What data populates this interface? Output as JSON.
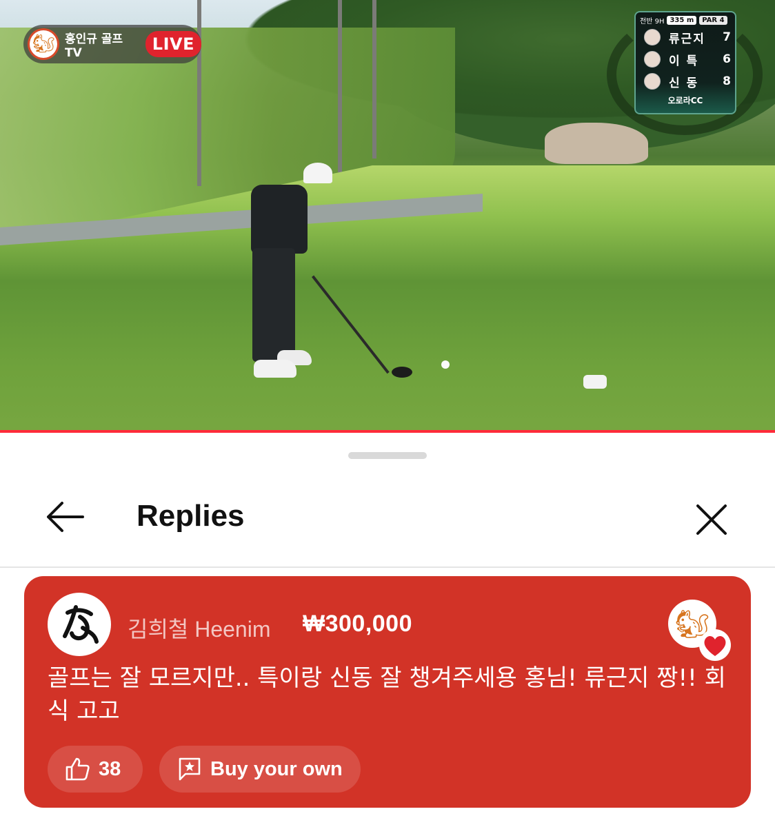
{
  "video": {
    "channel_name": "홍인규 골프TV",
    "live_label": "LIVE",
    "progress": 1.0,
    "scoreboard": {
      "round": "전반 9H",
      "distance": "335 m",
      "par": "PAR 4",
      "players": [
        {
          "name": "류근지",
          "score": "7"
        },
        {
          "name": "이 특",
          "score": "6"
        },
        {
          "name": "신 동",
          "score": "8"
        }
      ],
      "venue": "오로라CC"
    }
  },
  "sheet": {
    "title": "Replies",
    "back_icon": "arrow-left-icon",
    "close_icon": "close-icon"
  },
  "super_chat": {
    "author": "김희철 Heenim",
    "amount": "₩300,000",
    "message": "골프는 잘 모르지만.. 특이랑 신동 잘 챙겨주세용 홍님! 류근지 짱!! 회식 고고",
    "like_count": "38",
    "buy_label": "Buy your own",
    "card_color": "#d23327"
  }
}
